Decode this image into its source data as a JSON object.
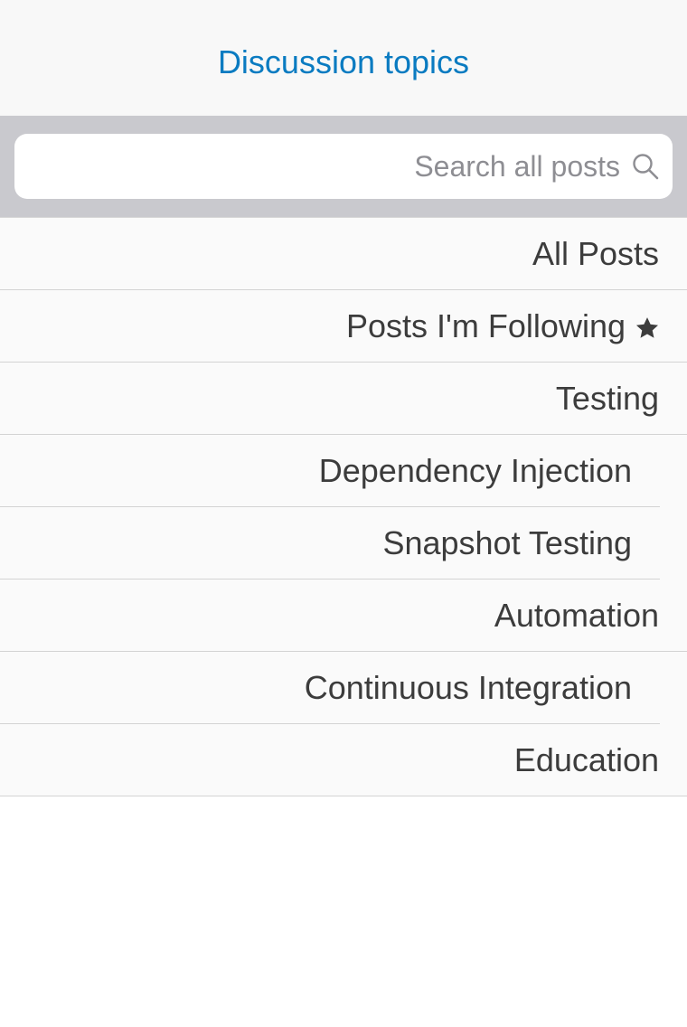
{
  "header": {
    "title": "Discussion topics"
  },
  "search": {
    "value": "",
    "placeholder": "Search all posts",
    "icon": "search-icon"
  },
  "topics": [
    {
      "label": "All Posts"
    },
    {
      "label": "Posts I'm Following",
      "icon": "star-icon"
    },
    {
      "label": "Testing"
    },
    {
      "label": "Dependency Injection",
      "parent": "Testing"
    },
    {
      "label": "Snapshot Testing",
      "parent": "Testing"
    },
    {
      "label": "Automation"
    },
    {
      "label": "Continuous Integration",
      "parent": "Automation"
    },
    {
      "label": "Education"
    }
  ],
  "colors": {
    "accent": "#0a7bc1",
    "search_bar_bg": "#c9c9ce",
    "row_text": "#3c3c3c",
    "placeholder": "#8e8e93"
  }
}
